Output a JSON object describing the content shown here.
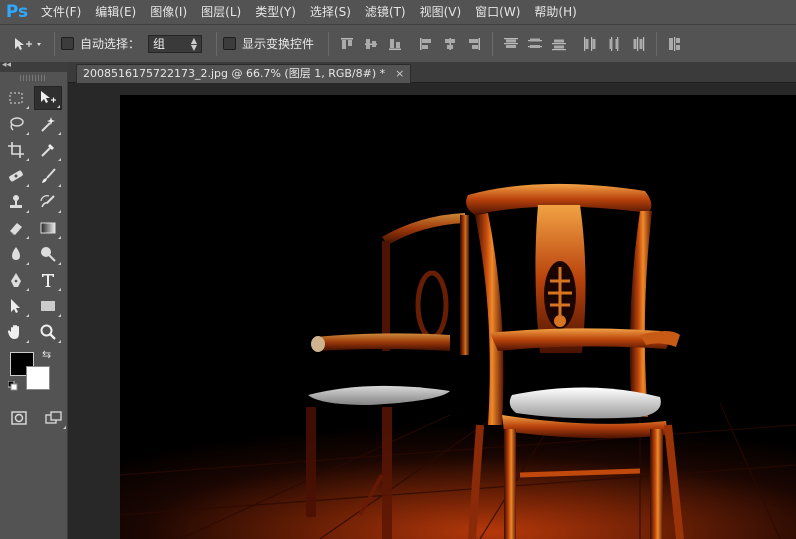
{
  "app": {
    "logo": "Ps"
  },
  "menu": [
    "文件(F)",
    "编辑(E)",
    "图像(I)",
    "图层(L)",
    "类型(Y)",
    "选择(S)",
    "滤镜(T)",
    "视图(V)",
    "窗口(W)",
    "帮助(H)"
  ],
  "options": {
    "auto_select_label": "自动选择：",
    "auto_select_value": "组",
    "show_transform_label": "显示变换控件"
  },
  "toolbox": {
    "collapse": "◂◂",
    "tools": [
      "marquee-icon",
      "move-icon",
      "lasso-icon",
      "magic-wand-icon",
      "crop-icon",
      "eyedropper-icon",
      "healing-brush-icon",
      "brush-icon",
      "clone-stamp-icon",
      "history-brush-icon",
      "eraser-icon",
      "gradient-icon",
      "blur-icon",
      "dodge-icon",
      "pen-icon",
      "type-icon",
      "path-select-icon",
      "rectangle-icon",
      "hand-icon",
      "zoom-icon"
    ],
    "foreground_color": "#000000",
    "background_color": "#ffffff"
  },
  "document": {
    "tab_title": "2008516175722173_2.jpg @ 66.7% (图层 1, RGB/8#) *",
    "close": "×"
  }
}
